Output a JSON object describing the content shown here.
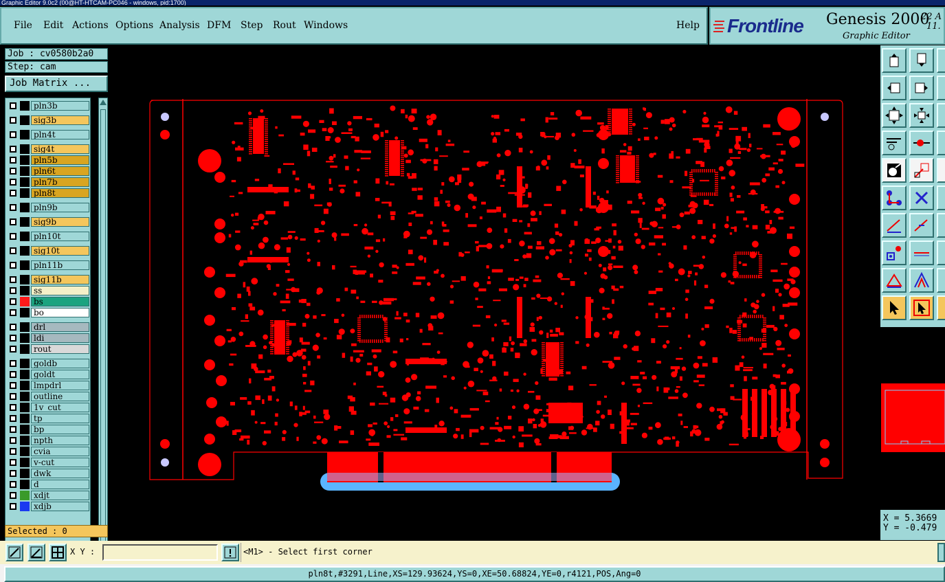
{
  "window": {
    "title": "Graphic Editor 9.0c2 (00@HT-HTCAM-PC046 - windows, pid:1700)"
  },
  "menu": {
    "file": "File",
    "edit": "Edit",
    "actions": "Actions",
    "options": "Options",
    "analysis": "Analysis",
    "dfm": "DFM",
    "step": "Step",
    "rout": "Rout",
    "windows": "Windows",
    "help": "Help"
  },
  "brand": {
    "logo": "Frontline",
    "product": "Genesis 2000",
    "subtitle": "Graphic Editor",
    "date_line1": "22 A",
    "date_line2": "11."
  },
  "job": {
    "job_label": "Job : cv0580b2a0",
    "step_label": "Step: cam",
    "matrix_button": "Job Matrix ..."
  },
  "layers": [
    {
      "name": "pln3b",
      "color": "#9fd7d7",
      "row_color": "#000000"
    },
    {
      "name": "sig3b",
      "color": "#f4c65c",
      "row_color": "#000000"
    },
    {
      "name": "pln4t",
      "color": "#9fd7d7",
      "row_color": "#000000"
    },
    {
      "name": "sig4t",
      "color": "#f4c65c",
      "row_color": "#000000"
    },
    {
      "name": "pln5b",
      "color": "#d9a521",
      "row_color": "#000000"
    },
    {
      "name": "pln6t",
      "color": "#d9a521",
      "row_color": "#000000"
    },
    {
      "name": "pln7b",
      "color": "#d9a521",
      "row_color": "#000000"
    },
    {
      "name": "pln8t",
      "color": "#d9a521",
      "row_color": "#000000"
    },
    {
      "name": "pln9b",
      "color": "#9fd7d7",
      "row_color": "#000000"
    },
    {
      "name": "sig9b",
      "color": "#f4c65c",
      "row_color": "#000000"
    },
    {
      "name": "pln10t",
      "color": "#9fd7d7",
      "row_color": "#000000"
    },
    {
      "name": "sig10t",
      "color": "#f4c65c",
      "row_color": "#000000"
    },
    {
      "name": "pln11b",
      "color": "#9fd7d7",
      "row_color": "#000000"
    },
    {
      "name": "sig11b",
      "color": "#f4c65c",
      "row_color": "#000000"
    },
    {
      "name": "ss",
      "color": "#f4f0c8",
      "row_color": "#000000"
    },
    {
      "name": "bs",
      "color": "#1ba37f",
      "row_color": "#ff1a1a"
    },
    {
      "name": "bo",
      "color": "#ffffff",
      "row_color": "#000000"
    },
    {
      "name": "drl",
      "color": "#a6b9bf",
      "row_color": "#000000"
    },
    {
      "name": "ldi",
      "color": "#a6b9bf",
      "row_color": "#000000"
    },
    {
      "name": "rout",
      "color": "#d9d9d9",
      "row_color": "#000000"
    },
    {
      "name": "goldb",
      "color": "#9fd7d7",
      "row_color": "#000000"
    },
    {
      "name": "goldt",
      "color": "#9fd7d7",
      "row_color": "#000000"
    },
    {
      "name": "lmpdrl",
      "color": "#9fd7d7",
      "row_color": "#000000"
    },
    {
      "name": "outline",
      "color": "#9fd7d7",
      "row_color": "#000000"
    },
    {
      "name": "1v_cut",
      "color": "#9fd7d7",
      "row_color": "#000000"
    },
    {
      "name": "tp",
      "color": "#9fd7d7",
      "row_color": "#000000"
    },
    {
      "name": "bp",
      "color": "#9fd7d7",
      "row_color": "#000000"
    },
    {
      "name": "npth",
      "color": "#9fd7d7",
      "row_color": "#000000"
    },
    {
      "name": "cvia",
      "color": "#9fd7d7",
      "row_color": "#000000"
    },
    {
      "name": "v-cut",
      "color": "#9fd7d7",
      "row_color": "#000000"
    },
    {
      "name": "dwk",
      "color": "#9fd7d7",
      "row_color": "#000000"
    },
    {
      "name": "d",
      "color": "#9fd7d7",
      "row_color": "#000000"
    },
    {
      "name": "xdjt",
      "color": "#9fd7d7",
      "row_color": "#3a9a2a"
    },
    {
      "name": "xdjb",
      "color": "#9fd7d7",
      "row_color": "#1a3af0"
    }
  ],
  "selected": "Selected : 0",
  "coords": {
    "x": "X = 5.3669",
    "y": "Y = -0.479"
  },
  "command": {
    "xy_label": "X Y :",
    "xy_value": "",
    "prompt": "<M1> - Select first corner"
  },
  "status": "pln8t,#3291,Line,XS=129.93624,YS=0,XE=50.68824,YE=0,r4121,POS,Ang=0",
  "colors": {
    "panel": "#9fd7d7",
    "board_red": "#ff0000",
    "finger_blue": "#5ab4ff",
    "highlight": "#f4c65c"
  }
}
